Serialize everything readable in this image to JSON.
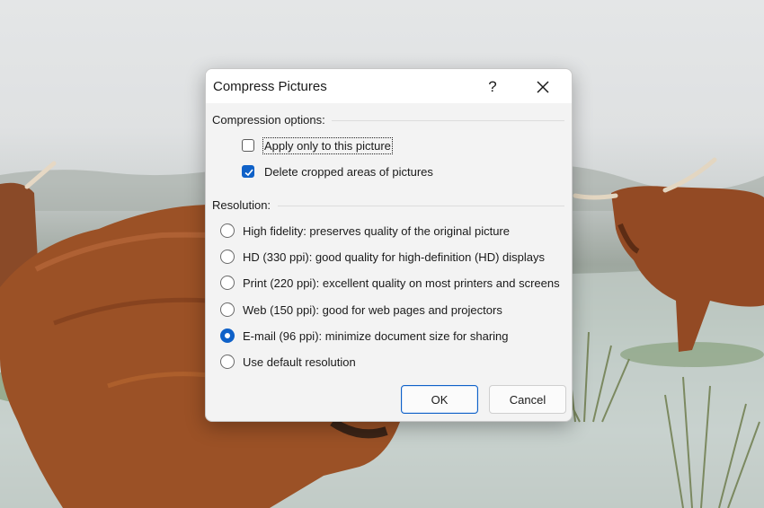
{
  "dialog": {
    "title": "Compress Pictures",
    "help_label": "?",
    "compression": {
      "label": "Compression options:",
      "options": [
        {
          "label": "Apply only to this picture",
          "checked": false
        },
        {
          "label": "Delete cropped areas of pictures",
          "checked": true
        }
      ]
    },
    "resolution": {
      "label": "Resolution:",
      "options": [
        {
          "label": "High fidelity: preserves quality of the original picture",
          "selected": false
        },
        {
          "label": "HD (330 ppi): good quality for high-definition (HD) displays",
          "selected": false
        },
        {
          "label": "Print (220 ppi): excellent quality on most printers and screens",
          "selected": false
        },
        {
          "label": "Web (150 ppi): good for web pages and projectors",
          "selected": false
        },
        {
          "label": "E-mail (96 ppi): minimize document size for sharing",
          "selected": true
        },
        {
          "label": "Use default resolution",
          "selected": false
        }
      ]
    },
    "ok_label": "OK",
    "cancel_label": "Cancel"
  },
  "colors": {
    "accent": "#0f61c8",
    "dialog_bg": "#f3f3f3"
  }
}
